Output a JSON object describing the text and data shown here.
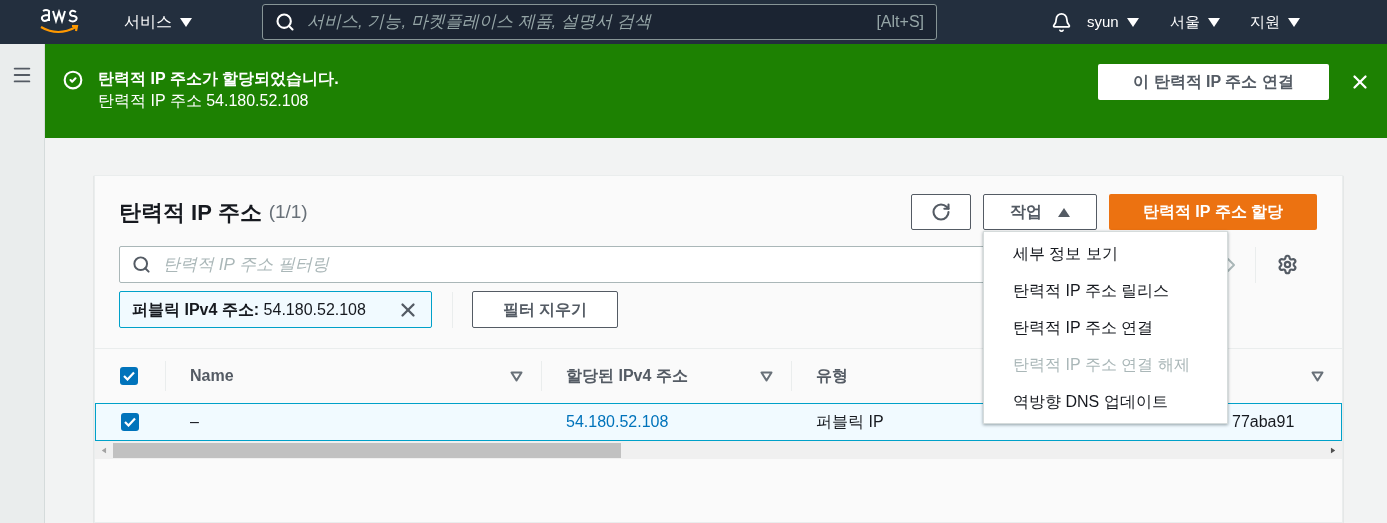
{
  "top_nav": {
    "services": "서비스",
    "search": {
      "placeholder": "서비스, 기능, 마켓플레이스 제품, 설명서 검색",
      "shortcut": "[Alt+S]"
    },
    "user": "syun",
    "region": "서울",
    "support": "지원"
  },
  "banner": {
    "title": "탄력적 IP 주소가 할당되었습니다.",
    "message": "탄력적 IP 주소 54.180.52.108",
    "action": "이 탄력적 IP 주소 연결"
  },
  "panel": {
    "title": "탄력적 IP 주소",
    "count": "(1/1)",
    "actions_button": "작업",
    "actions_expanded": true,
    "allocate_button": "탄력적 IP 주소 할당",
    "filter": {
      "placeholder": "탄력적 IP 주소 필터링"
    },
    "token": {
      "key": "퍼블릭 IPv4 주소:",
      "value": "54.180.52.108"
    },
    "clear_button": "필터 지우기",
    "actions_menu": [
      {
        "label": "세부 정보 보기",
        "disabled": false
      },
      {
        "label": "탄력적 IP 주소 릴리스",
        "disabled": false
      },
      {
        "label": "탄력적 IP 주소 연결",
        "disabled": false
      },
      {
        "label": "탄력적 IP 주소 연결 해제",
        "disabled": true
      },
      {
        "label": "역방향 DNS 업데이트",
        "disabled": false
      }
    ],
    "table": {
      "all_checked": true,
      "columns": [
        "Name",
        "할당된 IPv4 주소",
        "유형"
      ],
      "rows": [
        {
          "selected": true,
          "cells": [
            "–",
            "54.180.52.108",
            "퍼블릭 IP",
            "77aba91"
          ]
        }
      ]
    }
  }
}
